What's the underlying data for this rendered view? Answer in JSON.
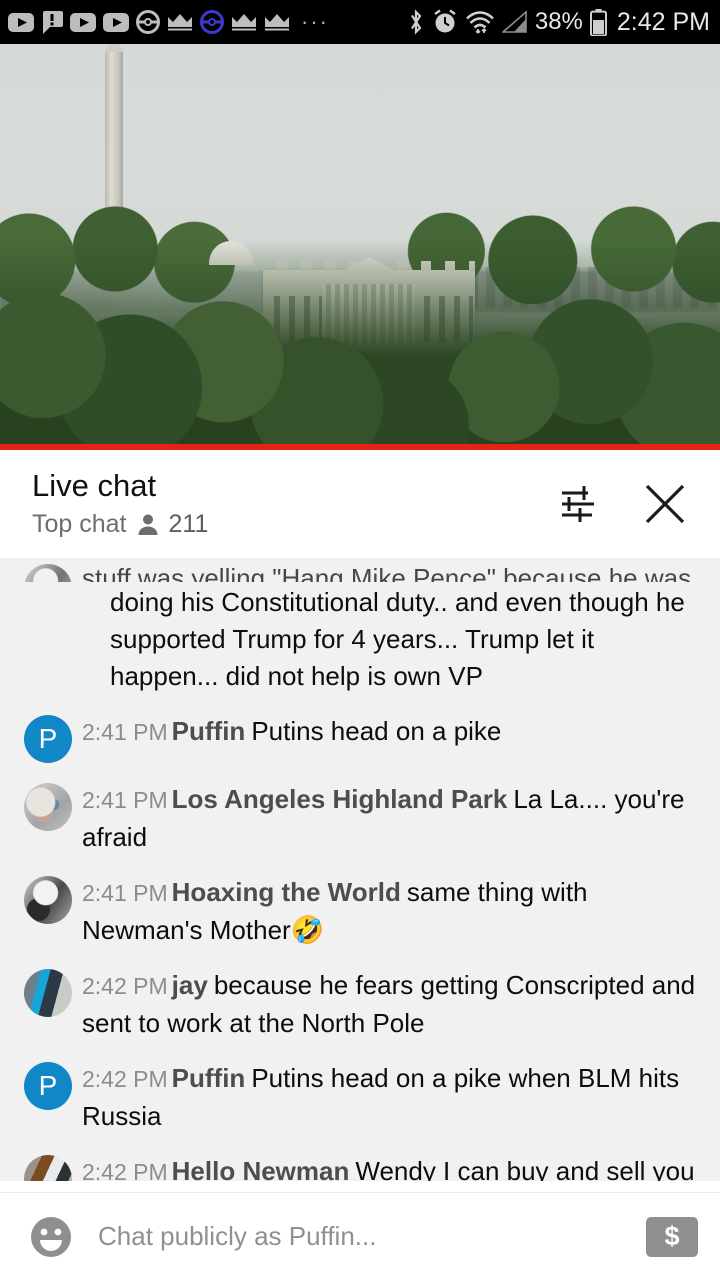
{
  "status_bar": {
    "notification_icons": [
      "youtube-icon",
      "chat-alert-icon",
      "youtube-icon",
      "youtube-icon",
      "pokeball-icon",
      "crown-icon",
      "pokeball-blue-icon",
      "crown-icon",
      "crown-icon"
    ],
    "overflow_dots": "···",
    "system_icons": [
      "bluetooth-icon",
      "alarm-icon",
      "wifi-icon",
      "signal-icon"
    ],
    "battery_percent": "38%",
    "battery_icon": "battery-icon",
    "time": "2:42 PM"
  },
  "video": {
    "progress_percent": 100,
    "progress_color": "#e62117",
    "scene": "White House with Washington Monument"
  },
  "chat_header": {
    "title": "Live chat",
    "mode": "Top chat",
    "viewer_icon": "person-icon",
    "viewer_count": "211",
    "settings_icon": "sliders-icon",
    "close_icon": "close-icon"
  },
  "messages": [
    {
      "clipped": true,
      "avatar": "photo",
      "avatar_style": "av-gray",
      "time": "",
      "author": "",
      "body": "stuff was yelling \"Hang Mike Pence\" because he was"
    },
    {
      "continuation": true,
      "avatar": "none",
      "time": "",
      "author": "",
      "body": "doing his Constitutional duty.. and even though he supported Trump for 4 years... Trump let it happen... did not help is own VP"
    },
    {
      "avatar": "initial",
      "avatar_initial": "P",
      "avatar_color": "#1287c8",
      "time": "2:41 PM",
      "author": "Puffin",
      "body": "Putins head on a pike"
    },
    {
      "avatar": "photo",
      "avatar_style": "av-cat",
      "time": "2:41 PM",
      "author": "Los Angeles Highland Park",
      "body": "La La.... you're afraid"
    },
    {
      "avatar": "photo",
      "avatar_style": "av-gray",
      "time": "2:41 PM",
      "author": "Hoaxing the World",
      "body": "same thing with Newman's Mother",
      "emoji": "🤣"
    },
    {
      "avatar": "photo",
      "avatar_style": "av-blue",
      "time": "2:42 PM",
      "author": "jay",
      "body": "because he fears getting Conscripted and sent to work at the North Pole"
    },
    {
      "avatar": "initial",
      "avatar_initial": "P",
      "avatar_color": "#1287c8",
      "time": "2:42 PM",
      "author": "Puffin",
      "body": "Putins head on a pike when BLM hits Russia"
    },
    {
      "avatar": "photo",
      "avatar_style": "av-wood",
      "time": "2:42 PM",
      "author": "Hello Newman",
      "body": "Wendy I can buy and sell you"
    }
  ],
  "composer": {
    "emoji_icon": "emoji-smiley-icon",
    "placeholder": "Chat publicly as Puffin...",
    "superchat_icon": "dollar-icon",
    "superchat_label": "$"
  }
}
